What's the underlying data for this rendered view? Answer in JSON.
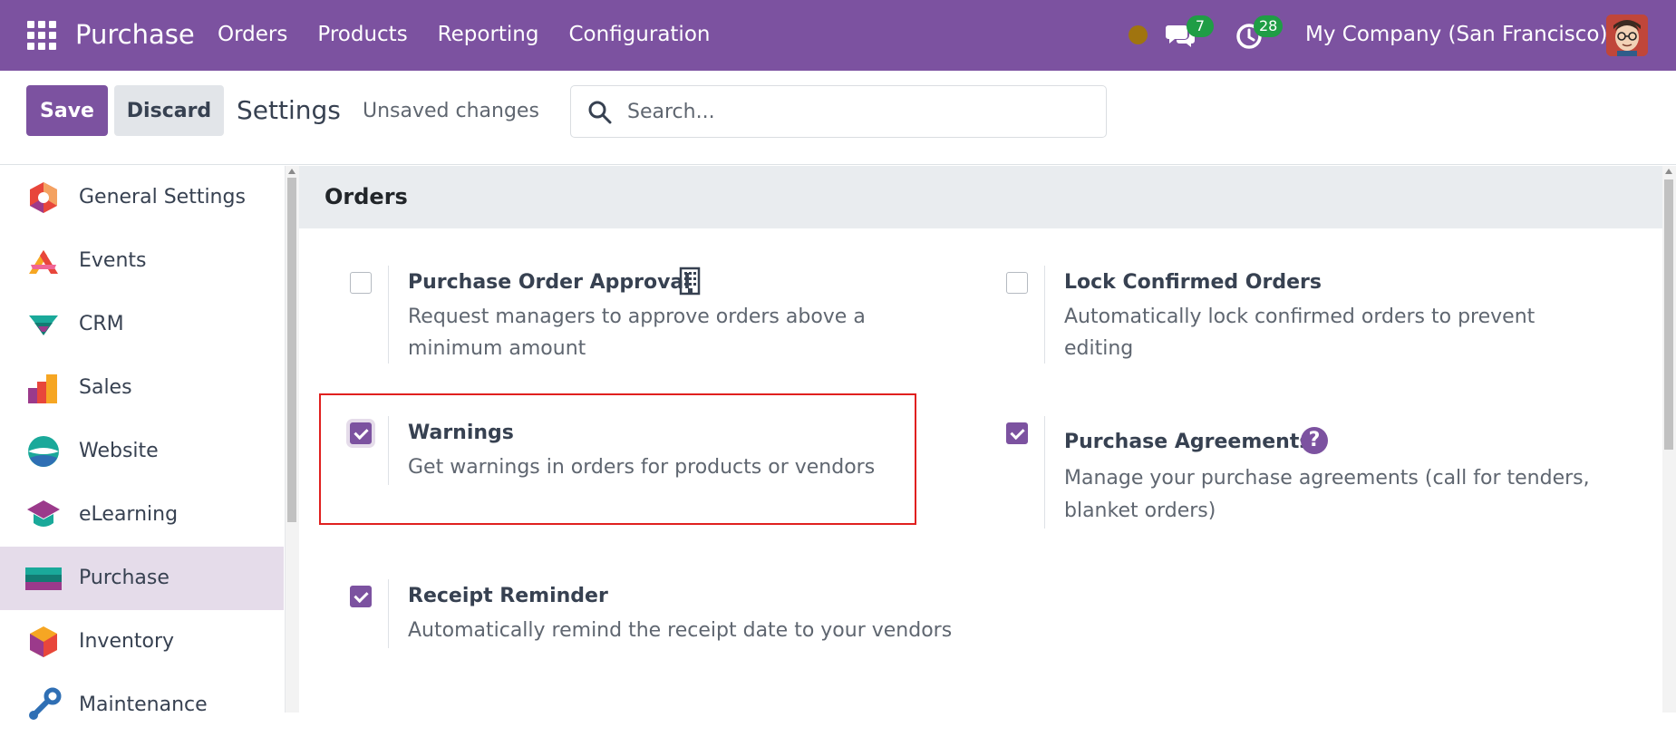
{
  "navbar": {
    "brand": "Purchase",
    "menu": [
      "Orders",
      "Products",
      "Reporting",
      "Configuration"
    ],
    "messages_count": "7",
    "activities_count": "28",
    "company": "My Company (San Francisco)",
    "icons": [
      "apps-grid-icon",
      "status-dot-icon",
      "chat-icon",
      "clock-icon",
      "avatar"
    ]
  },
  "control": {
    "save_label": "Save",
    "discard_label": "Discard",
    "title": "Settings",
    "status": "Unsaved changes",
    "search_placeholder": "Search..."
  },
  "sidebar": {
    "items": [
      {
        "label": "General Settings",
        "icon": "general-settings-icon"
      },
      {
        "label": "Events",
        "icon": "events-icon"
      },
      {
        "label": "CRM",
        "icon": "crm-icon"
      },
      {
        "label": "Sales",
        "icon": "sales-icon"
      },
      {
        "label": "Website",
        "icon": "website-icon"
      },
      {
        "label": "eLearning",
        "icon": "elearning-icon"
      },
      {
        "label": "Purchase",
        "icon": "purchase-icon",
        "active": true
      },
      {
        "label": "Inventory",
        "icon": "inventory-icon"
      },
      {
        "label": "Maintenance",
        "icon": "maintenance-icon"
      }
    ]
  },
  "section": {
    "title": "Orders",
    "settings": [
      {
        "title": "Purchase Order Approval",
        "desc1": "Request managers to approve orders above a",
        "desc2": "minimum amount",
        "checked": false
      },
      {
        "title": "Lock Confirmed Orders",
        "desc1": "Automatically lock confirmed orders to prevent",
        "desc2": "editing",
        "checked": false
      },
      {
        "title": "Warnings",
        "desc1": "Get warnings in orders for products or vendors",
        "checked": true
      },
      {
        "title": "Purchase Agreements",
        "desc1": "Manage your purchase agreements (call for tenders,",
        "desc2": "blanket orders)",
        "checked": true
      },
      {
        "title": "Receipt Reminder",
        "desc1": "Automatically remind the receipt date to your vendors",
        "checked": true
      }
    ],
    "help_glyph": "?"
  },
  "colors": {
    "brand": "#7c52a0",
    "badge": "#1f9d45",
    "highlight": "#e0201f",
    "active_sidebar": "#e5dcea"
  }
}
